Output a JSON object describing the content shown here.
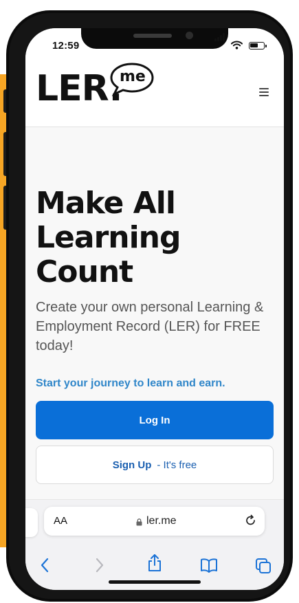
{
  "status_bar": {
    "time": "12:59",
    "icons": [
      "signal-icon",
      "wifi-icon",
      "battery-icon"
    ]
  },
  "header": {
    "logo_main": "LER.",
    "logo_bubble": "me",
    "menu_icon": "hamburger-menu-icon"
  },
  "hero": {
    "title": "Make All Learning Count",
    "subtitle": "Create your own personal Learning & Employment Record (LER) for FREE today!",
    "journey_link": "Start your journey to learn and earn."
  },
  "buttons": {
    "login_label": "Log In",
    "signup_label": "Sign Up",
    "signup_note": "- It's free"
  },
  "browser": {
    "text_size_label": "AA",
    "url": "ler.me",
    "toolbar_icons": [
      "back-icon",
      "forward-icon",
      "share-icon",
      "bookmarks-icon",
      "tabs-icon"
    ]
  },
  "colors": {
    "accent_orange": "#f6a524",
    "primary_blue": "#0a6fd8",
    "link_blue": "#2f86c9"
  }
}
